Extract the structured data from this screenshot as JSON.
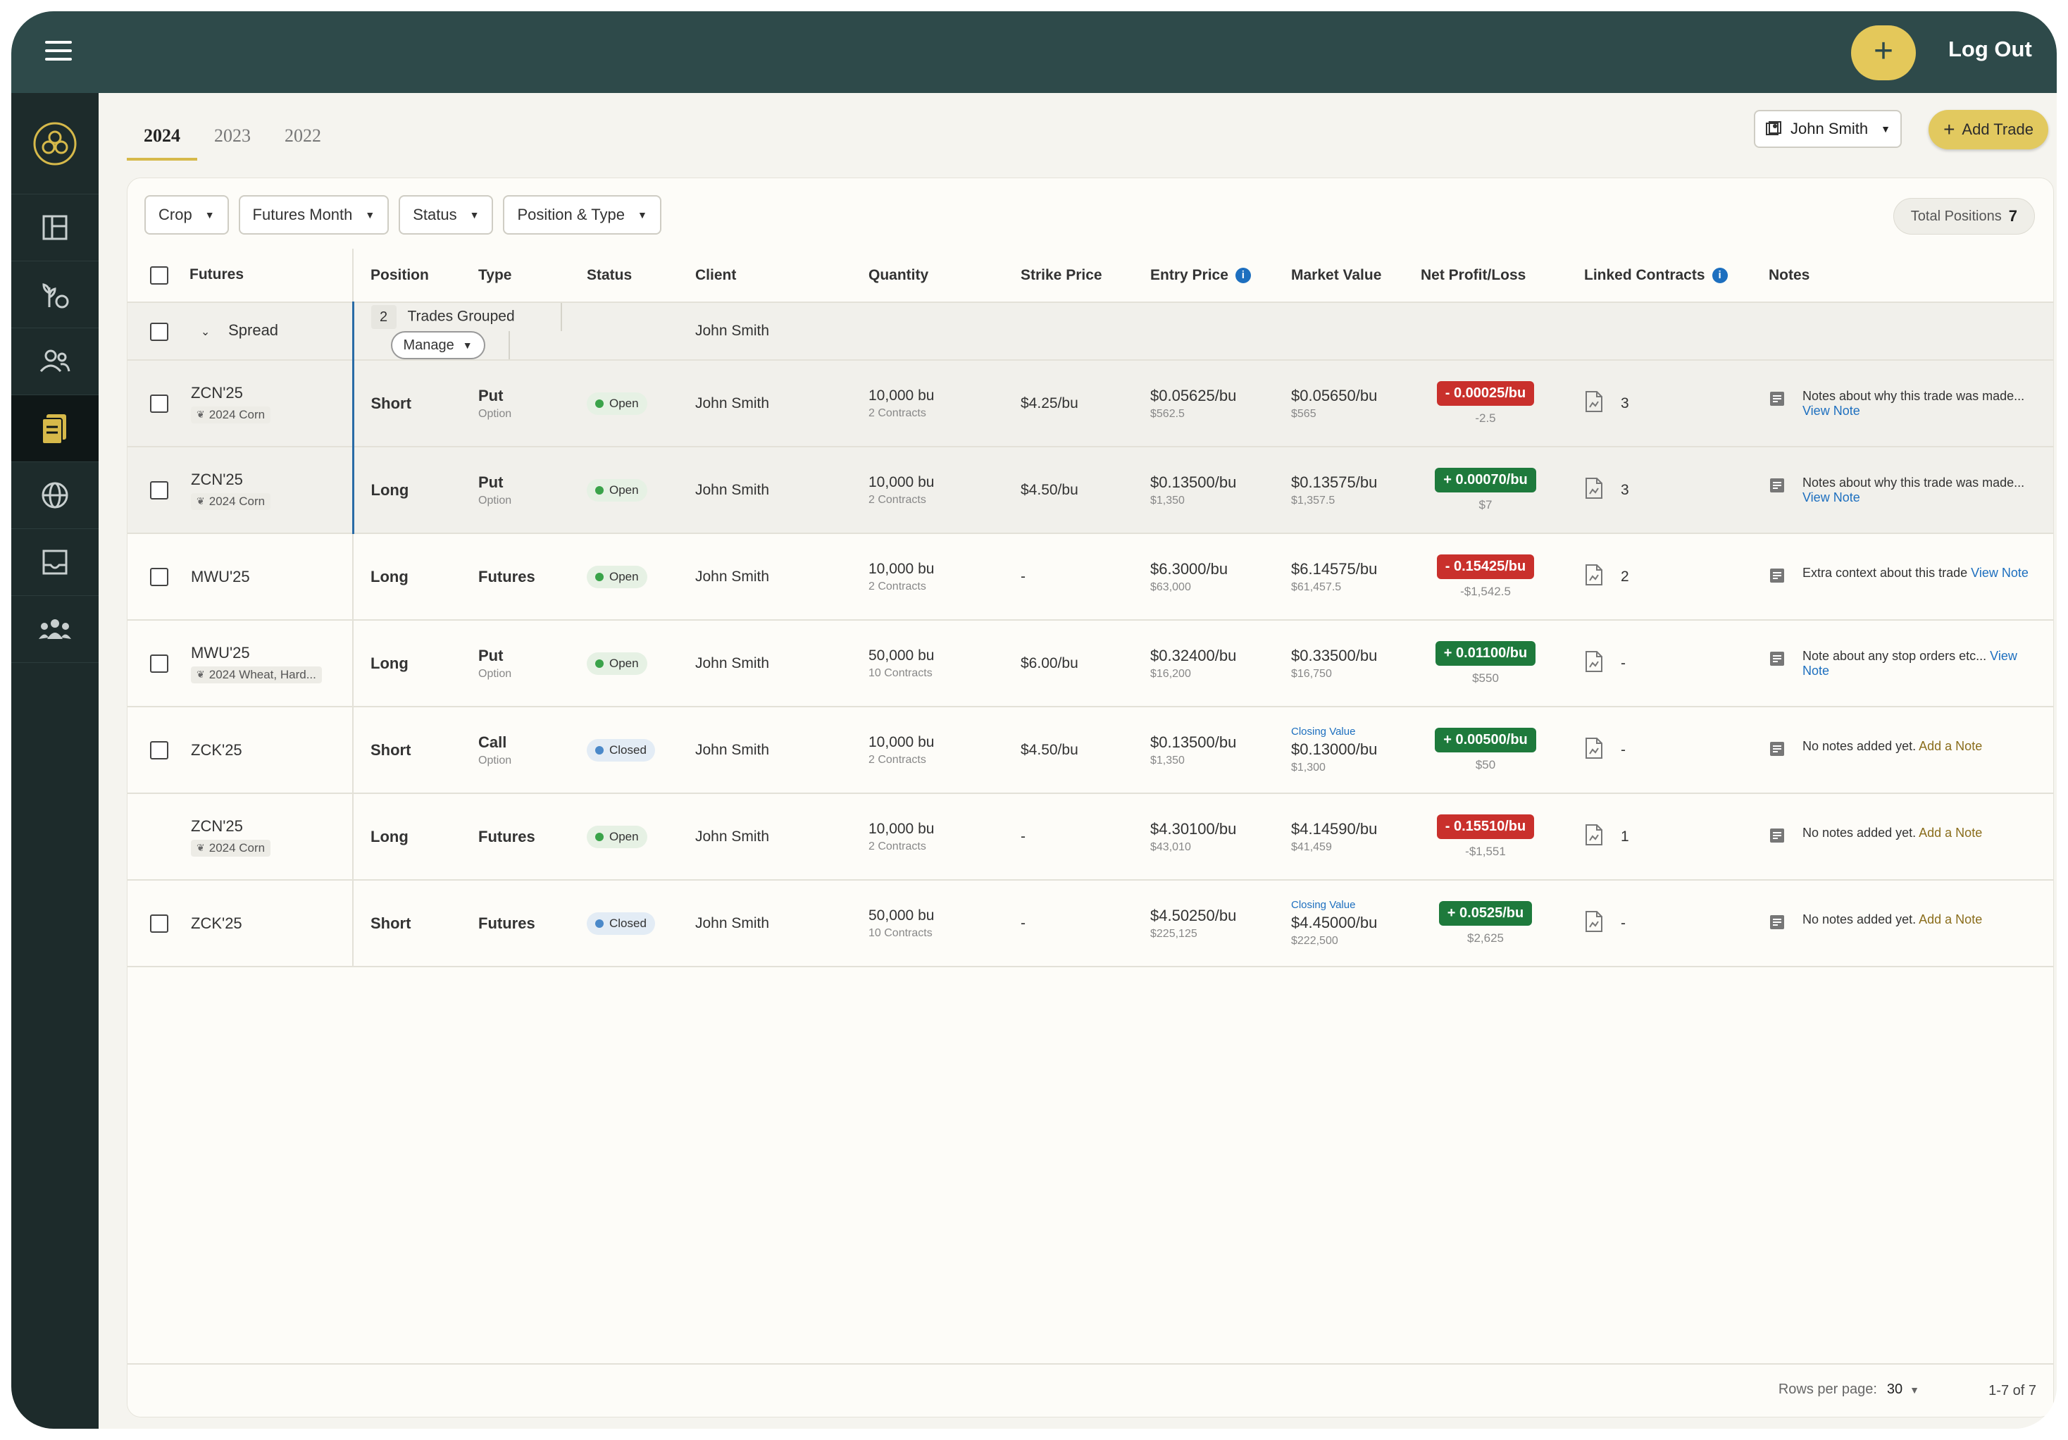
{
  "topbar": {
    "logout_label": "Log Out",
    "add_icon": "plus"
  },
  "sidebar": {
    "items": [
      "dashboard-icon",
      "crop-icon",
      "clients-icon",
      "trades-icon",
      "markets-icon",
      "inbox-icon",
      "team-icon"
    ],
    "active": "trades-icon"
  },
  "year_tabs": [
    "2024",
    "2023",
    "2022"
  ],
  "active_year": "2024",
  "client_select": {
    "label": "John Smith"
  },
  "add_trade": {
    "label": "Add Trade"
  },
  "filters": {
    "crop": "Crop",
    "futures_month": "Futures Month",
    "status": "Status",
    "position_type": "Position & Type"
  },
  "total_positions": {
    "label": "Total Positions",
    "value": "7"
  },
  "columns": {
    "futures": "Futures",
    "position": "Position",
    "type": "Type",
    "status": "Status",
    "client": "Client",
    "quantity": "Quantity",
    "strike": "Strike Price",
    "entry": "Entry Price",
    "market": "Market Value",
    "pnl": "Net Profit/Loss",
    "linked": "Linked Contracts",
    "notes": "Notes"
  },
  "group": {
    "name": "Spread",
    "count": "2",
    "label": "Trades Grouped",
    "manage": "Manage",
    "client": "John Smith"
  },
  "rows": [
    {
      "futures": "ZCN'25",
      "crop": "2024 Corn",
      "position": "Short",
      "type": "Put",
      "type_sub": "Option",
      "status": "Open",
      "client": "John Smith",
      "qty": "10,000 bu",
      "qty_sub": "2 Contracts",
      "strike": "$4.25/bu",
      "entry": "$0.05625/bu",
      "entry_sub": "$562.5",
      "closing": "",
      "market": "$0.05650/bu",
      "market_sub": "$565",
      "pnl": "- 0.00025/bu",
      "pnl_sub": "-2.5",
      "linked": "3",
      "note": "Notes about why this trade was made...",
      "note_link": "View Note"
    },
    {
      "futures": "ZCN'25",
      "crop": "2024 Corn",
      "position": "Long",
      "type": "Put",
      "type_sub": "Option",
      "status": "Open",
      "client": "John Smith",
      "qty": "10,000 bu",
      "qty_sub": "2 Contracts",
      "strike": "$4.50/bu",
      "entry": "$0.13500/bu",
      "entry_sub": "$1,350",
      "closing": "",
      "market": "$0.13575/bu",
      "market_sub": "$1,357.5",
      "pnl": "+ 0.00070/bu",
      "pnl_sub": "$7",
      "linked": "3",
      "note": "Notes about why this trade was made...",
      "note_link": "View Note"
    },
    {
      "futures": "MWU'25",
      "crop": "",
      "position": "Long",
      "type": "Futures",
      "type_sub": "",
      "status": "Open",
      "client": "John Smith",
      "qty": "10,000 bu",
      "qty_sub": "2 Contracts",
      "strike": "-",
      "entry": "$6.3000/bu",
      "entry_sub": "$63,000",
      "closing": "",
      "market": "$6.14575/bu",
      "market_sub": "$61,457.5",
      "pnl": "- 0.15425/bu",
      "pnl_sub": "-$1,542.5",
      "linked": "2",
      "note": "Extra context about this trade",
      "note_link": "View Note"
    },
    {
      "futures": "MWU'25",
      "crop": "2024 Wheat, Hard...",
      "position": "Long",
      "type": "Put",
      "type_sub": "Option",
      "status": "Open",
      "client": "John Smith",
      "qty": "50,000 bu",
      "qty_sub": "10 Contracts",
      "strike": "$6.00/bu",
      "entry": "$0.32400/bu",
      "entry_sub": "$16,200",
      "closing": "",
      "market": "$0.33500/bu",
      "market_sub": "$16,750",
      "pnl": "+ 0.01100/bu",
      "pnl_sub": "$550",
      "linked": "-",
      "note": "Note about any stop orders etc...",
      "note_link": "View Note"
    },
    {
      "futures": "ZCK'25",
      "crop": "",
      "position": "Short",
      "type": "Call",
      "type_sub": "Option",
      "status": "Closed",
      "client": "John Smith",
      "qty": "10,000 bu",
      "qty_sub": "2 Contracts",
      "strike": "$4.50/bu",
      "entry": "$0.13500/bu",
      "entry_sub": "$1,350",
      "closing": "Closing Value",
      "market": "$0.13000/bu",
      "market_sub": "$1,300",
      "pnl": "+ 0.00500/bu",
      "pnl_sub": "$50",
      "linked": "-",
      "note": "No notes added yet.",
      "note_add": "Add a Note"
    },
    {
      "futures": "ZCN'25",
      "crop": "2024 Corn",
      "position": "Long",
      "type": "Futures",
      "type_sub": "",
      "status": "Open",
      "client": "John Smith",
      "qty": "10,000 bu",
      "qty_sub": "2 Contracts",
      "strike": "-",
      "entry": "$4.30100/bu",
      "entry_sub": "$43,010",
      "closing": "",
      "market": "$4.14590/bu",
      "market_sub": "$41,459",
      "pnl": "- 0.15510/bu",
      "pnl_sub": "-$1,551",
      "linked": "1",
      "note": "No notes added yet.",
      "note_add": "Add a Note"
    },
    {
      "futures": "ZCK'25",
      "crop": "",
      "position": "Short",
      "type": "Futures",
      "type_sub": "",
      "status": "Closed",
      "client": "John Smith",
      "qty": "50,000 bu",
      "qty_sub": "10 Contracts",
      "strike": "-",
      "entry": "$4.50250/bu",
      "entry_sub": "$225,125",
      "closing": "Closing Value",
      "market": "$4.45000/bu",
      "market_sub": "$222,500",
      "pnl": "+ 0.0525/bu",
      "pnl_sub": "$2,625",
      "linked": "-",
      "note": "No notes added yet.",
      "note_add": "Add a Note"
    }
  ],
  "pagination": {
    "rows_label": "Rows per page:",
    "rows_value": "30",
    "range": "1-7 of 7"
  },
  "colors": {
    "topbar": "#2e4a4a",
    "sidebar": "#1d2b2b",
    "accent": "#e2c95f",
    "negative": "#c9302c",
    "positive": "#1e7a3c",
    "link": "#1d6fbf"
  }
}
